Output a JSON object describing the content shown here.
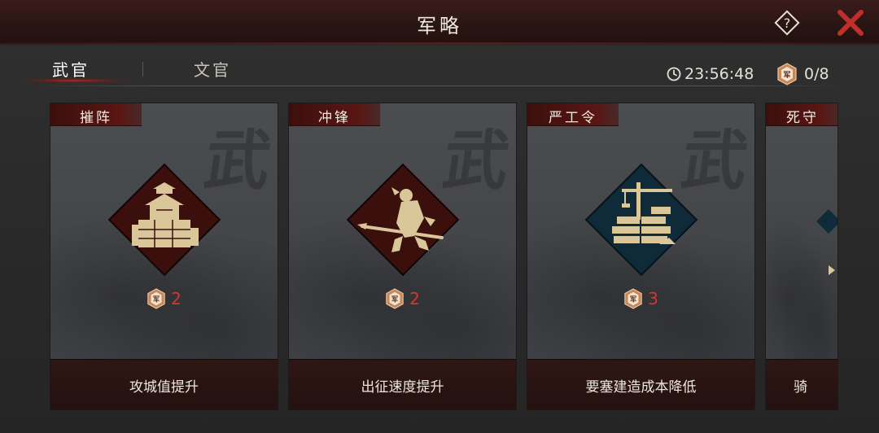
{
  "header": {
    "title": "军略"
  },
  "tabs": [
    {
      "label": "武官",
      "active": true
    },
    {
      "label": "文官",
      "active": false
    }
  ],
  "status": {
    "timer": "23:56:48",
    "points": "0/8"
  },
  "card_bg_char": "武",
  "cost_icon_char": "军",
  "cards": [
    {
      "label": "摧阵",
      "cost": "2",
      "description": "攻城值提升",
      "icon": "castle-icon",
      "diamond_color": "#3a0f0c"
    },
    {
      "label": "冲锋",
      "cost": "2",
      "description": "出征速度提升",
      "icon": "charging-warrior-icon",
      "diamond_color": "#3a0f0c"
    },
    {
      "label": "严工令",
      "cost": "3",
      "description": "要塞建造成本降低",
      "icon": "construction-icon",
      "diamond_color": "#0f2a38"
    },
    {
      "label": "死守",
      "cost": "",
      "description": "骑",
      "icon": "partial-card-icon",
      "diamond_color": "#0f2a38"
    }
  ],
  "colors": {
    "accent_red": "#d6372c",
    "gold": "#d9c79a",
    "panel_bg": "#2b2a29"
  }
}
